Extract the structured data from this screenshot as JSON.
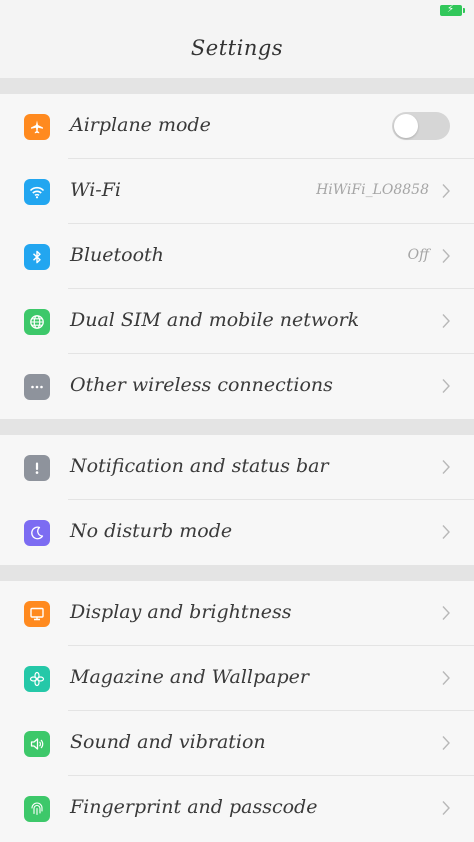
{
  "status_bar": {
    "battery_icon": "battery-charging-icon",
    "battery_color": "#31c75a"
  },
  "header": {
    "title": "Settings"
  },
  "groups": [
    {
      "items": [
        {
          "label": "Airplane mode",
          "icon": "airplane-icon",
          "color": "#ff8a1f",
          "toggle": {
            "on": false
          }
        },
        {
          "label": "Wi-Fi",
          "icon": "wifi-icon",
          "color": "#22a6f0",
          "value": "HiWiFi_LO8858"
        },
        {
          "label": "Bluetooth",
          "icon": "bluetooth-icon",
          "color": "#22a6f0",
          "value": "Off"
        },
        {
          "label": "Dual SIM and mobile network",
          "icon": "globe-icon",
          "color": "#3dc86a"
        },
        {
          "label": "Other wireless connections",
          "icon": "more-icon",
          "color": "#8e939c"
        }
      ]
    },
    {
      "items": [
        {
          "label": "Notification and status bar",
          "icon": "exclamation-icon",
          "color": "#8e939c"
        },
        {
          "label": "No disturb mode",
          "icon": "moon-icon",
          "color": "#7c6cf2"
        }
      ]
    },
    {
      "items": [
        {
          "label": "Display and brightness",
          "icon": "display-icon",
          "color": "#ff8a1f"
        },
        {
          "label": "Magazine and Wallpaper",
          "icon": "flower-icon",
          "color": "#25c8a8"
        },
        {
          "label": "Sound and vibration",
          "icon": "speaker-icon",
          "color": "#3dc86a"
        },
        {
          "label": "Fingerprint and passcode",
          "icon": "fingerprint-icon",
          "color": "#3dc86a"
        }
      ]
    }
  ]
}
